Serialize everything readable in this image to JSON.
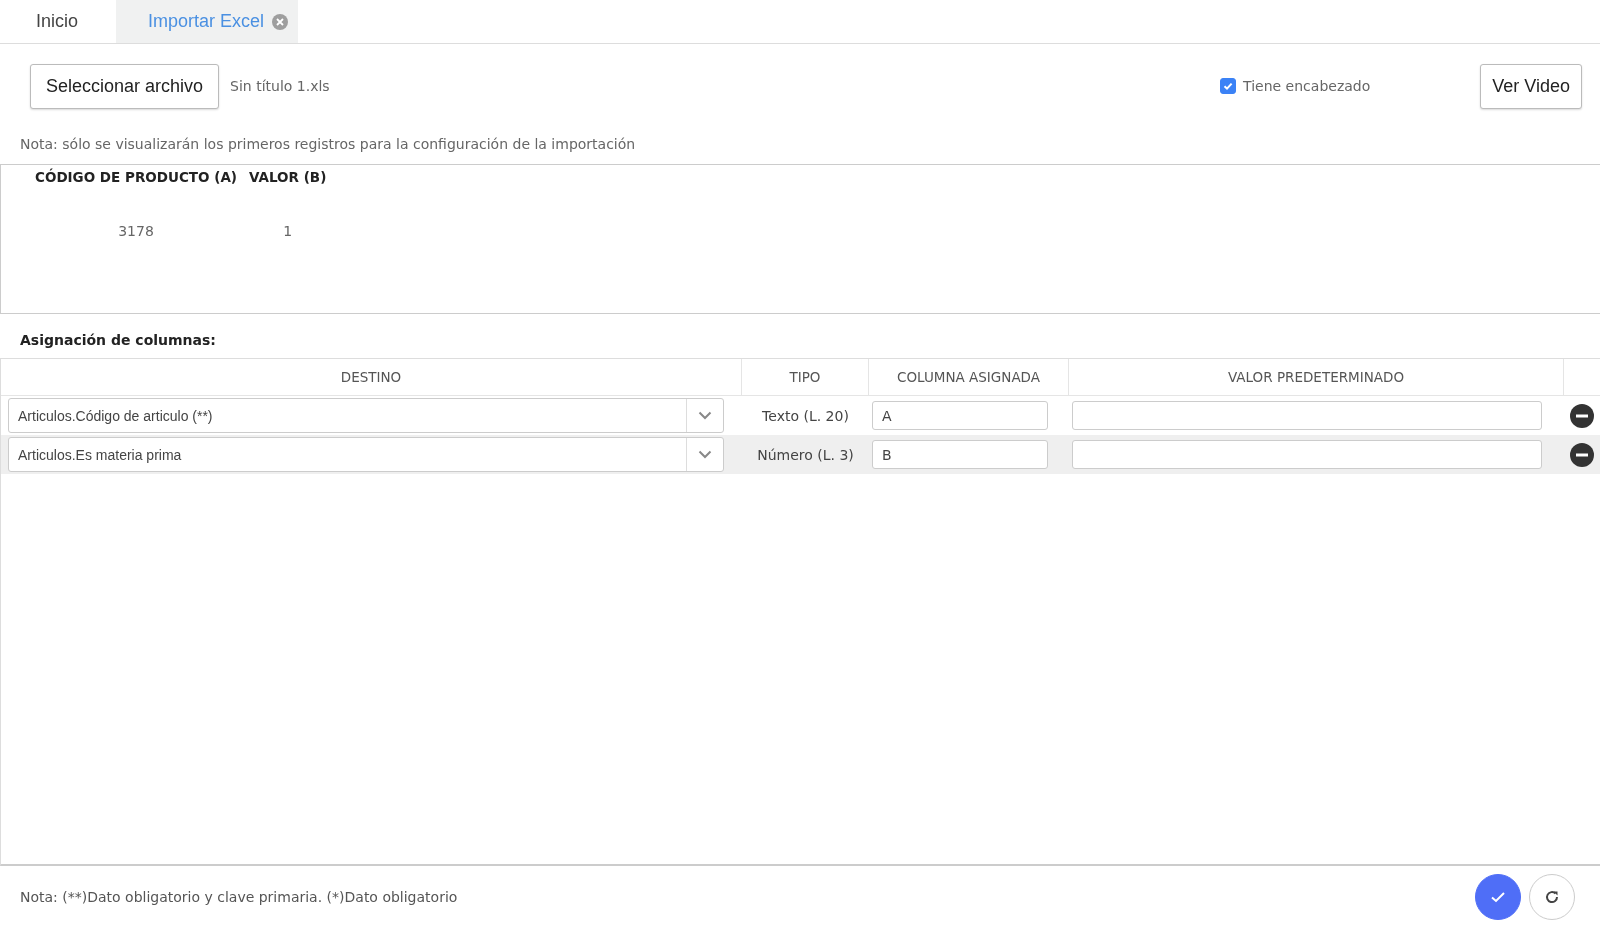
{
  "tabs": [
    {
      "label": "Inicio",
      "selected": false,
      "closable": false
    },
    {
      "label": "Importar Excel",
      "selected": true,
      "closable": true
    }
  ],
  "file_button": "Seleccionar archivo",
  "file_name": "Sin título 1.xls",
  "has_header": {
    "label": "Tiene encabezado",
    "checked": true
  },
  "video_button": "Ver Video",
  "preview_note": "Nota: sólo se visualizarán los primeros registros para la configuración de la importación",
  "preview": {
    "columns": [
      "CÓDIGO DE PRODUCTO (A)",
      "VALOR (B)"
    ],
    "rows": [
      [
        "3178",
        "1"
      ]
    ]
  },
  "mapping_title": "Asignación de columnas:",
  "mapping": {
    "columns": [
      "DESTINO",
      "TIPO",
      "COLUMNA ASIGNADA",
      "VALOR PREDETERMINADO"
    ],
    "rows": [
      {
        "destino": "Articulos.Código de articulo (**)",
        "tipo": "Texto (L. 20)",
        "columna": "A",
        "selected": false
      },
      {
        "destino": "Articulos.Es materia prima",
        "tipo": "Número (L. 3)",
        "columna": "B",
        "selected": true
      }
    ]
  },
  "footer_note": "Nota: (**)Dato obligatorio y clave primaria. (*)Dato obligatorio"
}
